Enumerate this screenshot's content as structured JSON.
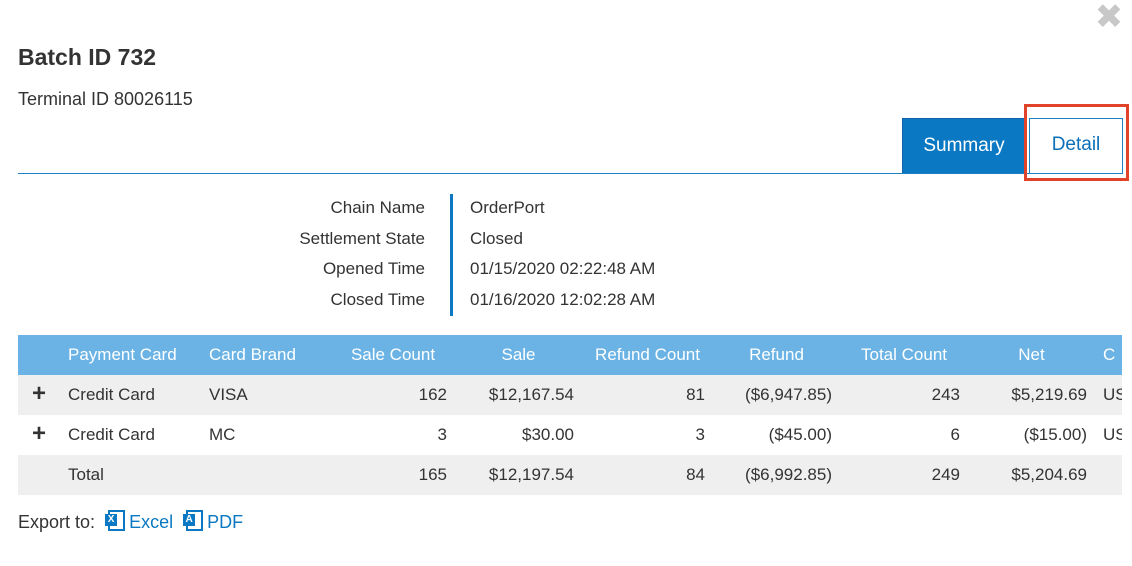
{
  "dialog": {
    "close_glyph": "✖",
    "title": "Batch ID 732",
    "terminal": "Terminal ID 80026115"
  },
  "tabs": [
    {
      "label": "Summary",
      "active": true
    },
    {
      "label": "Detail",
      "active": false
    }
  ],
  "info": [
    {
      "label": "Chain Name",
      "value": "OrderPort"
    },
    {
      "label": "Settlement State",
      "value": "Closed"
    },
    {
      "label": "Opened Time",
      "value": "01/15/2020 02:22:48 AM"
    },
    {
      "label": "Closed Time",
      "value": "01/16/2020 12:02:28 AM"
    }
  ],
  "table": {
    "headers": [
      "",
      "Payment Card",
      "Card Brand",
      "Sale Count",
      "Sale",
      "Refund Count",
      "Refund",
      "Total Count",
      "Net",
      "C"
    ],
    "rows": [
      [
        "+",
        "Credit Card",
        "VISA",
        "162",
        "$12,167.54",
        "81",
        "($6,947.85)",
        "243",
        "$5,219.69",
        "US"
      ],
      [
        "+",
        "Credit Card",
        "MC",
        "3",
        "$30.00",
        "3",
        "($45.00)",
        "6",
        "($15.00)",
        "US"
      ]
    ],
    "total": [
      "",
      "Total",
      "",
      "165",
      "$12,197.54",
      "84",
      "($6,992.85)",
      "249",
      "$5,204.69",
      ""
    ]
  },
  "export": {
    "label": "Export to:",
    "excel": "Excel",
    "pdf": "PDF"
  },
  "colors": {
    "accent": "#0a78c2",
    "header_bg": "#6bb3e4",
    "highlight": "#e0432a"
  }
}
